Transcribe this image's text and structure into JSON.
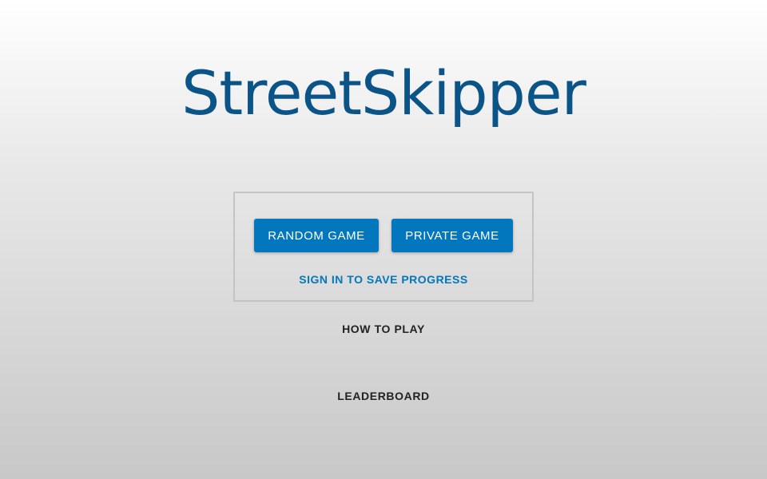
{
  "title": "StreetSkipper",
  "buttons": {
    "random": "RANDOM GAME",
    "private": "PRIVATE GAME"
  },
  "sign_in": "SIGN IN TO SAVE PROGRESS",
  "how_to_play": "HOW TO PLAY",
  "leaderboard": "LEADERBOARD",
  "colors": {
    "accent": "#0277bd",
    "title": "#0b5488"
  }
}
